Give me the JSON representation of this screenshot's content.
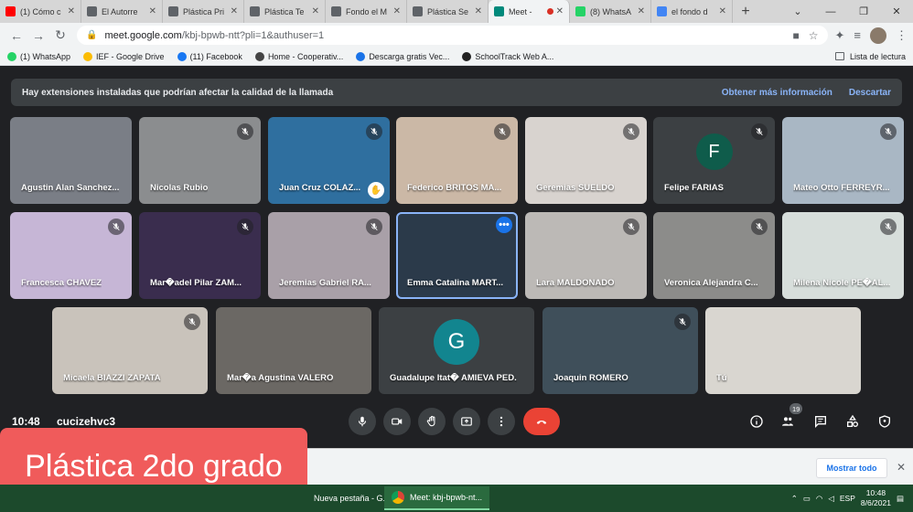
{
  "browser": {
    "tabs": [
      {
        "title": "(1) Cómo c",
        "color": "#ff0000",
        "active": false
      },
      {
        "title": "El Autorre",
        "color": "#5f6368",
        "active": false
      },
      {
        "title": "Plástica Pri",
        "color": "#5f6368",
        "active": false
      },
      {
        "title": "Plástica Te",
        "color": "#5f6368",
        "active": false
      },
      {
        "title": "Fondo el M",
        "color": "#5f6368",
        "active": false
      },
      {
        "title": "Plástica Se",
        "color": "#5f6368",
        "active": false
      },
      {
        "title": "Meet -",
        "color": "#00897b",
        "active": true
      },
      {
        "title": "(8) WhatsA",
        "color": "#25d366",
        "active": false
      },
      {
        "title": "el fondo d",
        "color": "#4285f4",
        "active": false
      }
    ],
    "url_host": "meet.google.com",
    "url_path": "/kbj-bpwb-ntt?pli=1&authuser=1",
    "bookmarks": [
      {
        "label": "(1) WhatsApp",
        "color": "#25d366"
      },
      {
        "label": "IEF - Google Drive",
        "color": "#fbbc04"
      },
      {
        "label": "(11) Facebook",
        "color": "#1877f2"
      },
      {
        "label": "Home - Cooperativ...",
        "color": "#444444"
      },
      {
        "label": "Descarga gratis Vec...",
        "color": "#1a73e8"
      },
      {
        "label": "SchoolTrack Web A...",
        "color": "#222222"
      }
    ],
    "reading_list": "Lista de lectura"
  },
  "meet": {
    "banner": {
      "text": "Hay extensiones instaladas que podrían afectar la calidad de la llamada",
      "learn_more": "Obtener más información",
      "dismiss": "Descartar"
    },
    "participants": [
      {
        "name": "Agustin Alan Sanchez...",
        "bg": "#7a7e86",
        "muted": false
      },
      {
        "name": "Nicolas Rubio",
        "bg": "#8b8d8f",
        "muted": true
      },
      {
        "name": "Juan Cruz COLAZ...",
        "bg": "#2f6f9f",
        "muted": true,
        "hand": true
      },
      {
        "name": "Federico BRITOS MA...",
        "bg": "#cbb8a6",
        "muted": true
      },
      {
        "name": "Geremias SUELDO",
        "bg": "#d8d3cf",
        "muted": true
      },
      {
        "name": "Felipe FARIAS",
        "bg": "#3c4043",
        "muted": true,
        "initial": "F",
        "initial_color": "#0f5c4b"
      },
      {
        "name": "Mateo Otto FERREYR...",
        "bg": "#a9b7c4",
        "muted": true
      },
      {
        "name": "Francesca CHAVEZ",
        "bg": "#c6b6d6",
        "muted": true
      },
      {
        "name": "Mar�adel Pilar ZAM...",
        "bg": "#3a2d4e",
        "muted": true
      },
      {
        "name": "Jeremias Gabriel RA...",
        "bg": "#a9a0a8",
        "muted": true
      },
      {
        "name": "Emma Catalina MART...",
        "bg": "#2b3a4a",
        "muted": false,
        "highlight": true
      },
      {
        "name": "Lara MALDONADO",
        "bg": "#bcb9b6",
        "muted": true
      },
      {
        "name": "Veronica Alejandra C...",
        "bg": "#8c8c8a",
        "muted": true
      },
      {
        "name": "Milena Nicole PE�AL...",
        "bg": "#d7dedb",
        "muted": true
      },
      {
        "name": "Micaela BIAZZI ZAPATA",
        "bg": "#c9c3bb",
        "muted": true
      },
      {
        "name": "Mar�a Agustina VALERO",
        "bg": "#6b6864",
        "muted": false
      },
      {
        "name": "Guadalupe Itat� AMIEVA PED...",
        "bg": "#3c4043",
        "muted": false,
        "initial": "G",
        "initial_color": "#12858f"
      },
      {
        "name": "Joaquin ROMERO",
        "bg": "#3f4f5a",
        "muted": true
      },
      {
        "name": "Tú",
        "bg": "#d9d6d0",
        "muted": false
      }
    ],
    "time": "10:48",
    "code": "cucizehvc3",
    "participant_count": "19"
  },
  "overlay_text": "Plástica 2do grado",
  "downloads": {
    "show_all": "Mostrar todo"
  },
  "taskbar": {
    "items": [
      "Nueva pestaña - G...",
      "Meet: kbj-bpwb-nt..."
    ],
    "lang": "ESP",
    "clock_time": "10:48",
    "clock_date": "8/6/2021"
  }
}
